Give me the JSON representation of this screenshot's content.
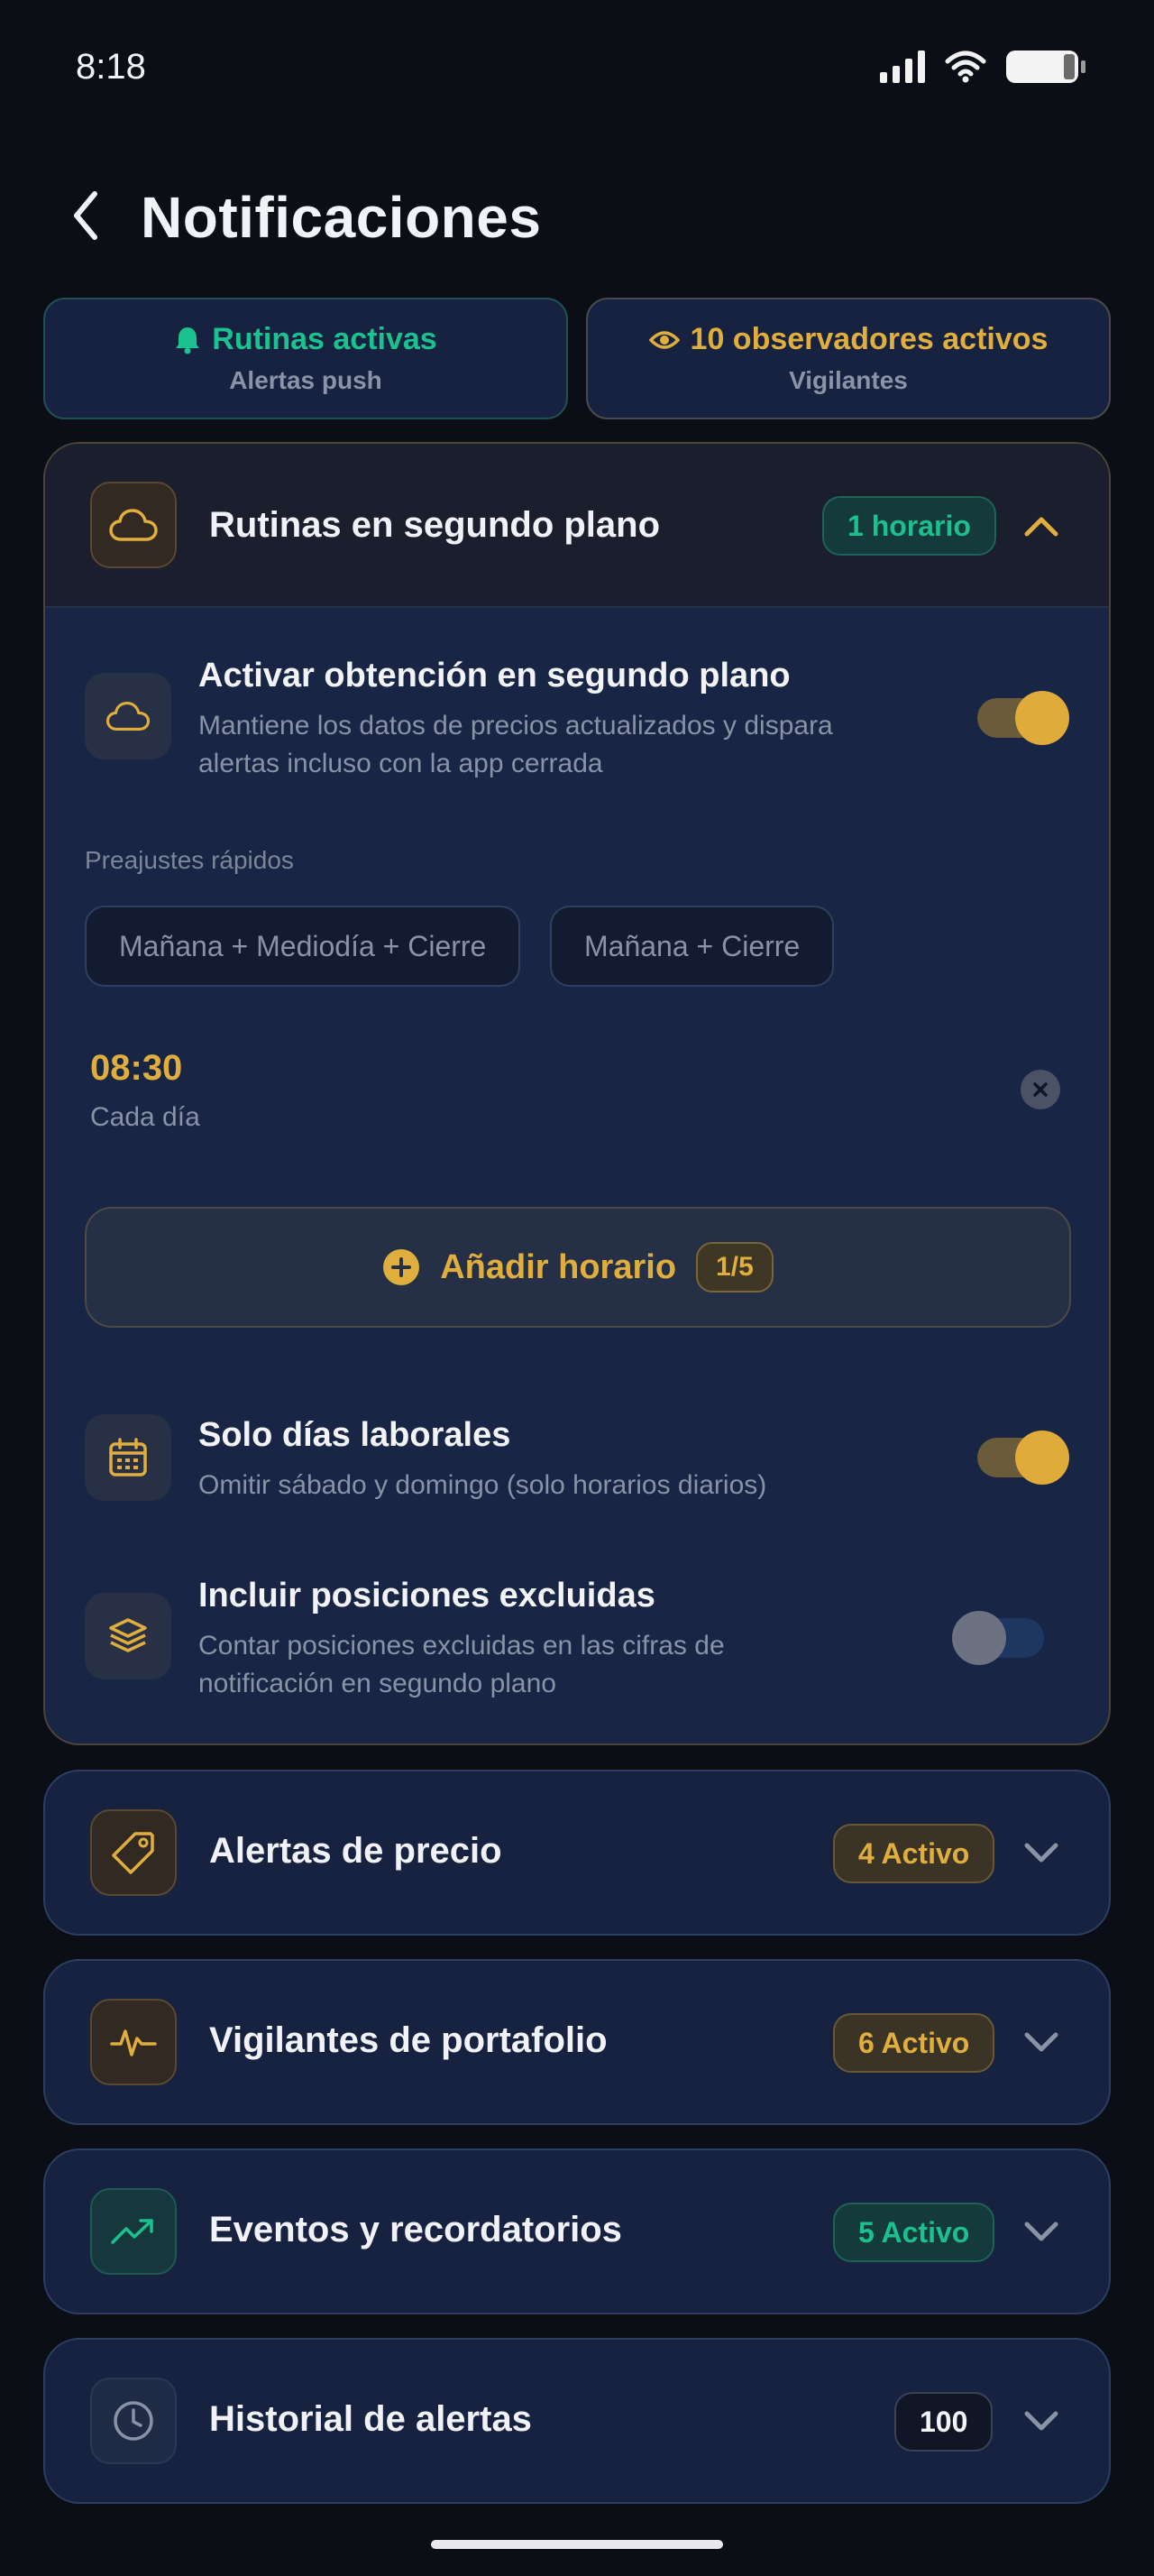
{
  "status_bar": {
    "time": "8:18"
  },
  "header": {
    "title": "Notificaciones"
  },
  "summary": {
    "left": {
      "title": "Rutinas activas",
      "subtitle": "Alertas push",
      "color": "#19c28f",
      "icon": "bell-icon"
    },
    "right": {
      "title": "10 observadores activos",
      "subtitle": "Vigilantes",
      "color": "#e0ae3c",
      "icon": "eye-icon"
    }
  },
  "background_routines": {
    "title": "Rutinas en segundo plano",
    "badge": "1 horario",
    "icon": "cloud-icon",
    "fetch": {
      "title": "Activar obtención en segundo plano",
      "description_line1": "Mantiene los datos de precios actualizados y dispara",
      "description_line2": "alertas incluso con la app cerrada",
      "enabled": true
    },
    "presets_label": "Preajustes rápidos",
    "presets": [
      "Mañana + Mediodía + Cierre",
      "Mañana + Cierre"
    ],
    "schedule": {
      "time": "08:30",
      "frequency": "Cada día"
    },
    "add_schedule": {
      "label": "Añadir horario",
      "count": "1/5"
    },
    "weekdays": {
      "title": "Solo días laborales",
      "description": "Omitir sábado y domingo (solo horarios diarios)",
      "enabled": true
    },
    "excluded": {
      "title": "Incluir posiciones excluidas",
      "description_line1": "Contar posiciones excluidas en las cifras de",
      "description_line2": "notificación en segundo plano",
      "enabled": false
    }
  },
  "cards": [
    {
      "title": "Alertas de precio",
      "badge": "4 Activo",
      "icon": "tag-icon"
    },
    {
      "title": "Vigilantes de portafolio",
      "badge": "6 Activo",
      "icon": "pulse-icon"
    },
    {
      "title": "Eventos y recordatorios",
      "badge": "5 Activo",
      "icon": "trending-up-icon"
    },
    {
      "title": "Historial de alertas",
      "badge": "100",
      "icon": "clock-icon"
    }
  ]
}
